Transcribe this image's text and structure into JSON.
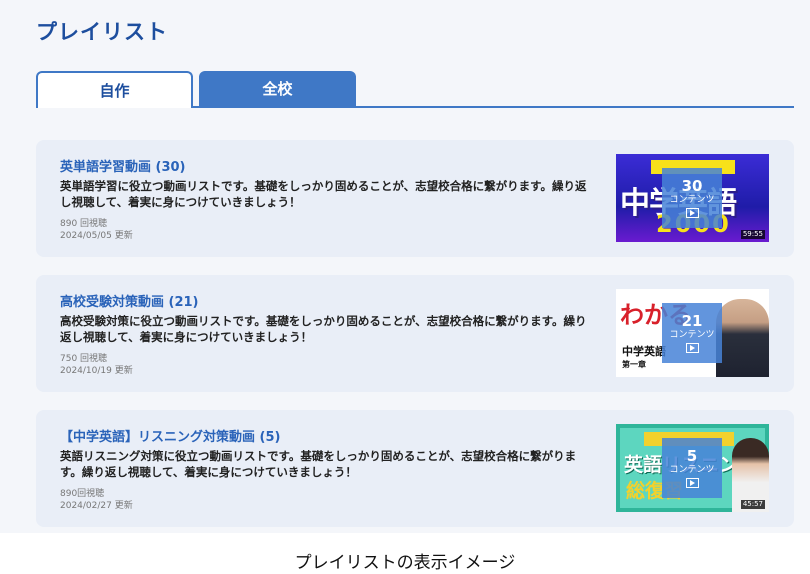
{
  "page": {
    "title": "プレイリスト"
  },
  "tabs": [
    {
      "label": "自作",
      "active": true
    },
    {
      "label": "全校",
      "active": false
    }
  ],
  "playlists": [
    {
      "title": "英単語学習動画 (30)",
      "description": "英単語学習に役立つ動画リストです。基礎をしっかり固めることが、志望校合格に繋がります。繰り返し視聴して、着実に身につけていきましょう！",
      "views": "890 回視聴",
      "updated": "2024/05/05 更新",
      "thumbnail": {
        "count": "30",
        "count_label": "コンテンツ",
        "duration": "59:55",
        "banner_text": "中学英語",
        "year_text": "2000"
      }
    },
    {
      "title": "高校受験対策動画 (21)",
      "description": "高校受験対策に役立つ動画リストです。基礎をしっかり固めることが、志望校合格に繋がります。繰り返し視聴して、着実に身につけていきましょう！",
      "views": "750 回視聴",
      "updated": "2024/10/19 更新",
      "thumbnail": {
        "count": "21",
        "count_label": "コンテンツ",
        "headline_text": "わかる",
        "sub_text": "中学英語",
        "chapter_text": "第一章"
      }
    },
    {
      "title": "【中学英語】リスニング対策動画 (5)",
      "description": "英語リスニング対策に役立つ動画リストです。基礎をしっかり固めることが、志望校合格に繋がります。繰り返し視聴して、着実に身につけていきましょう！",
      "views": "890回視聴",
      "updated": "2024/02/27 更新",
      "thumbnail": {
        "count": "5",
        "count_label": "コンテンツ",
        "duration": "45:57",
        "headline_text": "英語リスニング",
        "sub_text": "総復習"
      }
    }
  ],
  "caption": "プレイリストの表示イメージ",
  "colors": {
    "accent": "#3f78c6",
    "title": "#1d4e9e",
    "link": "#2a63b9",
    "card_bg": "#e9eef7"
  }
}
